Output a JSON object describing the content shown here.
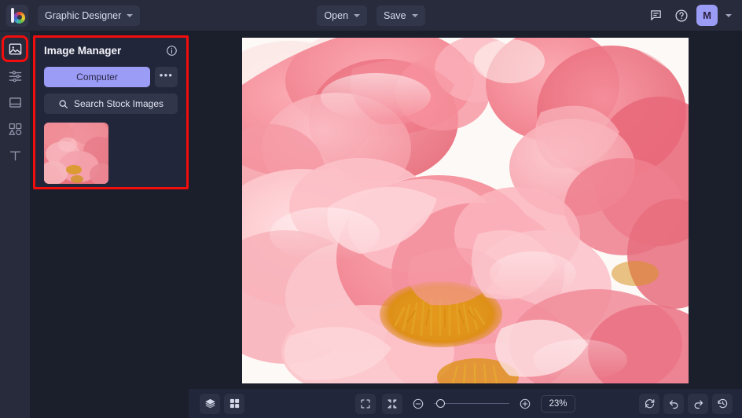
{
  "app": {
    "logo": "befunky-color-wheel-logo",
    "theme_bg": "#1b1e2b",
    "accent": "#9a9cf5",
    "highlight": "#f40d0d"
  },
  "topbar": {
    "project_label": "Graphic Designer",
    "open_label": "Open",
    "save_label": "Save",
    "feedback_icon": "comment-icon",
    "help_icon": "help-circle-icon",
    "avatar_initial": "M",
    "account_chevron": "chevron-down-icon"
  },
  "rail": {
    "items": [
      {
        "name": "image-manager",
        "icon": "image-icon",
        "active": true,
        "highlighted": true
      },
      {
        "name": "edit-adjust",
        "icon": "sliders-icon",
        "active": false,
        "highlighted": false
      },
      {
        "name": "frames",
        "icon": "frame-icon",
        "active": false,
        "highlighted": false
      },
      {
        "name": "graphics",
        "icon": "shapes-icon",
        "active": false,
        "highlighted": false
      },
      {
        "name": "text",
        "icon": "text-t-icon",
        "active": false,
        "highlighted": false
      }
    ]
  },
  "panel": {
    "title": "Image Manager",
    "info_icon": "info-circle-icon",
    "computer_label": "Computer",
    "more_label": "•••",
    "search_stock_label": "Search Stock Images",
    "search_icon": "search-icon",
    "thumbnails": [
      {
        "name": "peonies-thumbnail",
        "alt": "pink peony flowers close-up"
      }
    ]
  },
  "canvas": {
    "image_name": "pink-peonies-photo",
    "background": "#fdf8f4"
  },
  "bottombar": {
    "layers_icon": "layers-icon",
    "grid_icon": "grid-icon",
    "fit_screen_icon": "fit-to-screen-icon",
    "collapse_icon": "collapse-arrows-icon",
    "zoom_out_icon": "zoom-out-circle-icon",
    "zoom_in_icon": "zoom-in-circle-icon",
    "zoom_level": "23%",
    "zoom_slider_value": 4,
    "reset_icon": "reset-rotate-icon",
    "undo_icon": "undo-arrow-icon",
    "redo_icon": "redo-arrow-icon",
    "history_icon": "history-clock-icon"
  }
}
